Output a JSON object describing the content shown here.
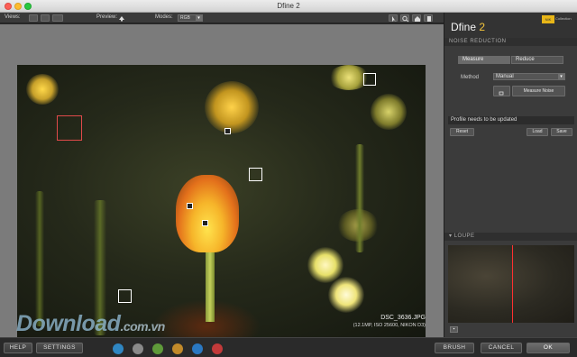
{
  "window": {
    "title": "Dfine 2"
  },
  "toolbar": {
    "views_label": "Views:",
    "preview_label": "Preview:",
    "modes_label": "Modes:",
    "mode_value": "RGB"
  },
  "image": {
    "filename": "DSC_3636.JPG",
    "details": "(12.1MP, ISO 25600, NIKON D3)"
  },
  "watermark": {
    "main": "Download",
    "suffix": ".com.vn"
  },
  "panel": {
    "product_name": "Dfine",
    "product_version": "2",
    "brand_badge": "NIK",
    "brand_collection": "Collection",
    "section_noise": "NOISE REDUCTION",
    "tab_measure": "Measure",
    "tab_reduce": "Reduce",
    "method_label": "Method",
    "method_value": "Manual",
    "measure_noise_button": "Measure Noise",
    "profile_status": "Profile needs to be updated",
    "reset_button": "Reset",
    "load_button": "Load",
    "save_button": "Save",
    "section_loupe": "LOUPE"
  },
  "bottom": {
    "help": "HELP",
    "settings": "SETTINGS",
    "brush": "BRUSH",
    "cancel": "CANCEL",
    "ok": "OK",
    "color_dots": [
      "#2f86c2",
      "#8a8a8a",
      "#5f9a3a",
      "#c28a2a",
      "#2a78c2",
      "#c23a3a"
    ]
  }
}
